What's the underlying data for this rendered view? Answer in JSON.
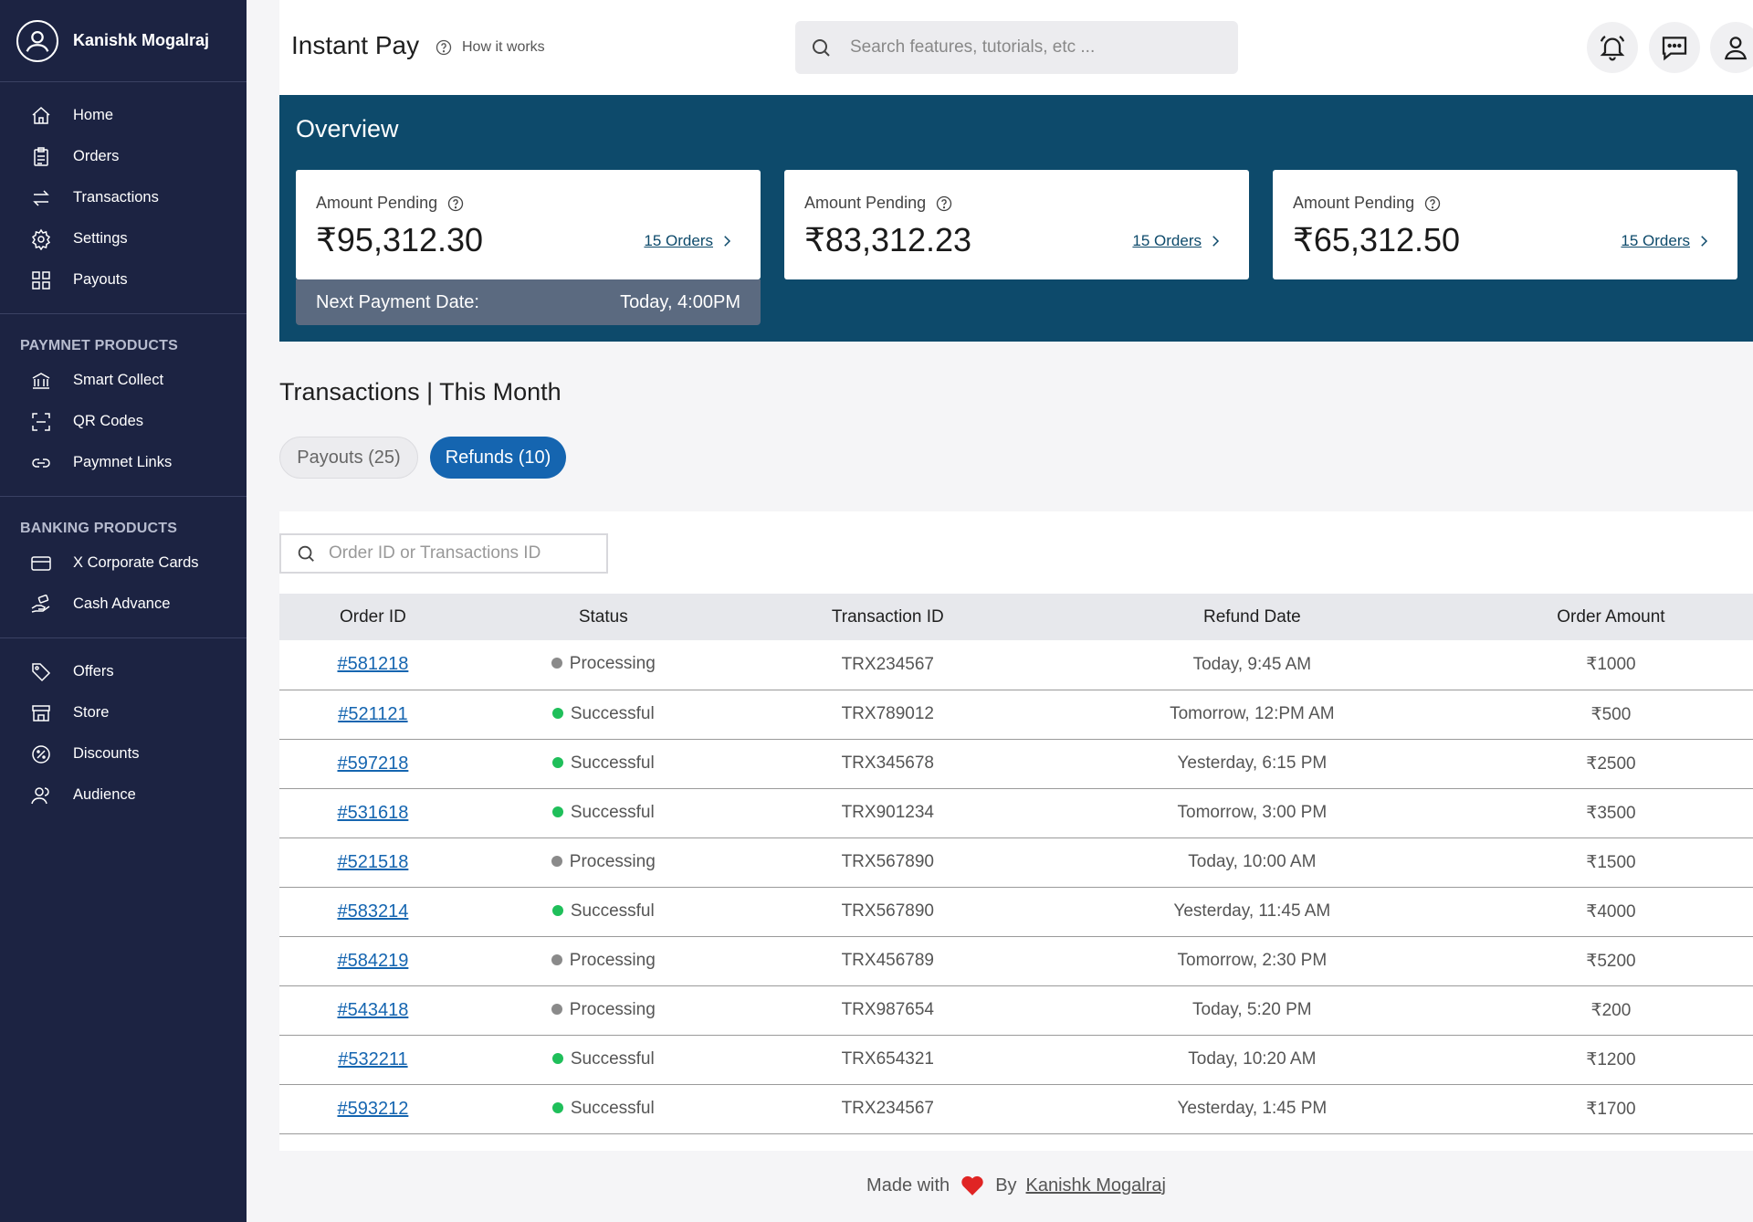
{
  "user": {
    "name": "Kanishk Mogalraj"
  },
  "sidebar": {
    "main_items": [
      {
        "label": "Home",
        "icon": "home-icon"
      },
      {
        "label": "Orders",
        "icon": "clipboard-icon"
      },
      {
        "label": "Transactions",
        "icon": "arrows-icon"
      },
      {
        "label": "Settings",
        "icon": "gear-icon"
      },
      {
        "label": "Payouts",
        "icon": "grid-icon"
      }
    ],
    "payment_title": "PAYMNET PRODUCTS",
    "payment_items": [
      {
        "label": "Smart Collect",
        "icon": "bank-icon"
      },
      {
        "label": "QR Codes",
        "icon": "qr-scan-icon"
      },
      {
        "label": "Paymnet Links",
        "icon": "link-icon"
      }
    ],
    "banking_title": "BANKING PRODUCTS",
    "banking_items": [
      {
        "label": "X Corporate Cards",
        "icon": "card-icon"
      },
      {
        "label": "Cash Advance",
        "icon": "cash-hand-icon"
      }
    ],
    "other_items": [
      {
        "label": "Offers",
        "icon": "tag-icon"
      },
      {
        "label": "Store",
        "icon": "store-icon"
      },
      {
        "label": "Discounts",
        "icon": "discount-icon"
      },
      {
        "label": "Audience",
        "icon": "users-icon"
      }
    ]
  },
  "header": {
    "title": "Instant Pay",
    "how_it_works": "How it works",
    "search_placeholder": "Search features, tutorials, etc ..."
  },
  "overview": {
    "title": "Overview",
    "cards": [
      {
        "label": "Amount Pending",
        "amount": "₹95,312.30",
        "orders": "15 Orders"
      },
      {
        "label": "Amount Pending",
        "amount": "₹83,312.23",
        "orders": "15 Orders"
      },
      {
        "label": "Amount Pending",
        "amount": "₹65,312.50",
        "orders": "15 Orders"
      }
    ],
    "next_payment_label": "Next Payment Date:",
    "next_payment_value": "Today, 4:00PM"
  },
  "transactions": {
    "title": "Transactions | This Month",
    "tabs": [
      {
        "label": "Payouts (25)",
        "active": false
      },
      {
        "label": "Refunds (10)",
        "active": true
      }
    ],
    "filter_placeholder": "Order ID or Transactions ID",
    "columns": [
      "Order ID",
      "Status",
      "Transaction ID",
      "Refund Date",
      "Order Amount"
    ],
    "status_colors": {
      "Processing": "#8a8a8a",
      "Successful": "#1fbf5a"
    },
    "rows": [
      {
        "order_id": "#581218",
        "status": "Processing",
        "transaction_id": "TRX234567",
        "refund_date": "Today, 9:45 AM",
        "amount": "₹1000"
      },
      {
        "order_id": "#521121",
        "status": "Successful",
        "transaction_id": "TRX789012",
        "refund_date": "Tomorrow, 12:PM AM",
        "amount": "₹500"
      },
      {
        "order_id": "#597218",
        "status": "Successful",
        "transaction_id": "TRX345678",
        "refund_date": "Yesterday, 6:15 PM",
        "amount": "₹2500"
      },
      {
        "order_id": "#531618",
        "status": "Successful",
        "transaction_id": "TRX901234",
        "refund_date": "Tomorrow, 3:00 PM",
        "amount": "₹3500"
      },
      {
        "order_id": "#521518",
        "status": "Processing",
        "transaction_id": "TRX567890",
        "refund_date": "Today, 10:00 AM",
        "amount": "₹1500"
      },
      {
        "order_id": "#583214",
        "status": "Successful",
        "transaction_id": "TRX567890",
        "refund_date": "Yesterday, 11:45 AM",
        "amount": "₹4000"
      },
      {
        "order_id": "#584219",
        "status": "Processing",
        "transaction_id": "TRX456789",
        "refund_date": "Tomorrow, 2:30 PM",
        "amount": "₹5200"
      },
      {
        "order_id": "#543418",
        "status": "Processing",
        "transaction_id": "TRX987654",
        "refund_date": "Today, 5:20 PM",
        "amount": "₹200"
      },
      {
        "order_id": "#532211",
        "status": "Successful",
        "transaction_id": "TRX654321",
        "refund_date": "Today, 10:20 AM",
        "amount": "₹1200"
      },
      {
        "order_id": "#593212",
        "status": "Successful",
        "transaction_id": "TRX234567",
        "refund_date": "Yesterday, 1:45 PM",
        "amount": "₹1700"
      }
    ]
  },
  "footer": {
    "made_with": "Made with",
    "by": "By",
    "author": "Kanishk Mogalraj",
    "heart_color": "#e02424"
  }
}
